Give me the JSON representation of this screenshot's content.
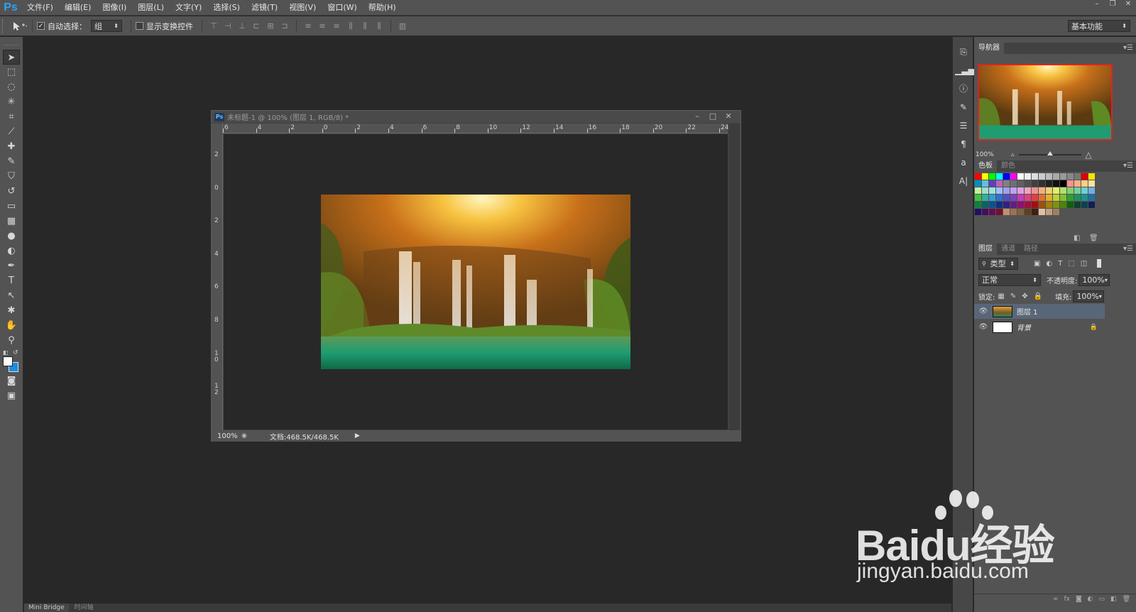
{
  "app": {
    "logo": "Ps"
  },
  "menu": [
    "文件(F)",
    "编辑(E)",
    "图像(I)",
    "图层(L)",
    "文字(Y)",
    "选择(S)",
    "滤镜(T)",
    "视图(V)",
    "窗口(W)",
    "帮助(H)"
  ],
  "window_controls": {
    "minimize": "–",
    "restore": "❐",
    "close": "✕"
  },
  "options": {
    "tool_icon": "move-tool-icon",
    "auto_select_label": "自动选择：",
    "auto_select_checked": true,
    "auto_select_value": "组",
    "transform_label": "显示变换控件",
    "transform_checked": false,
    "workspace": "基本功能"
  },
  "document": {
    "title": "未标题-1 @ 100% (图层 1, RGB/8) *",
    "zoom": "100%",
    "doc_info": "文档:468.5K/468.5K",
    "ruler_h": [
      "6",
      "4",
      "2",
      "0",
      "2",
      "4",
      "6",
      "8",
      "10",
      "12",
      "14",
      "16",
      "18",
      "20",
      "22",
      "24"
    ],
    "ruler_v": [
      "2",
      "0",
      "2",
      "4",
      "6",
      "8",
      "1\n0",
      "1\n2"
    ]
  },
  "bottom_tabs": [
    "Mini Bridge",
    "时间轴"
  ],
  "navigator": {
    "tab": "导航器",
    "zoom": "100%"
  },
  "swatch_tabs": [
    "色板",
    "颜色"
  ],
  "layers_panel": {
    "tabs": [
      "图层",
      "通道",
      "路径"
    ],
    "filter": "类型",
    "blend_mode": "正常",
    "opacity_label": "不透明度:",
    "opacity": "100%",
    "lock_label": "锁定:",
    "fill_label": "填充:",
    "fill": "100%",
    "layers": [
      {
        "name": "图层 1",
        "selected": true
      },
      {
        "name": "背景",
        "selected": false,
        "locked": true
      }
    ]
  },
  "watermark": {
    "brand": "Baidu经验",
    "url": "jingyan.baidu.com"
  },
  "colors": {
    "panel": "#535353",
    "dark": "#282828",
    "accent": "#2fa3f6",
    "selected_layer": "#596678"
  }
}
